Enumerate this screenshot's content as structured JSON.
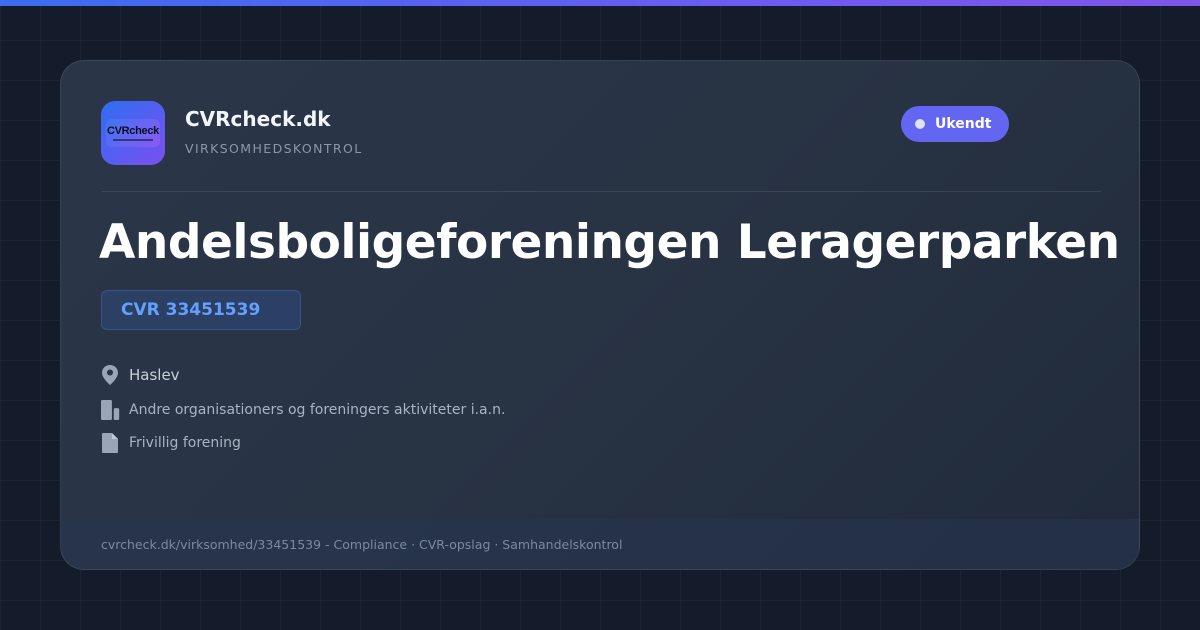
{
  "brand": {
    "logo_text": "CVRcheck",
    "name": "CVRcheck.dk",
    "tagline": "VIRKSOMHEDSKONTROL"
  },
  "status": {
    "label": "Ukendt",
    "color": "#6366f1"
  },
  "company": {
    "name": "Andelsboligeforeningen Leragerparken",
    "cvr": "CVR 33451539",
    "city": "Haslev",
    "industry": "Andre organisationers og foreningers aktiviteter i.a.n.",
    "company_type": "Frivillig forening"
  },
  "icons": {
    "city": "location-pin-icon",
    "industry": "building-icon",
    "company_type": "document-icon"
  },
  "footer": {
    "text": "cvrcheck.dk/virksomhed/33451539 - Compliance · CVR-opslag · Samhandelskontrol"
  },
  "colors": {
    "background": "#141c2c",
    "accent_blue": "#3b6df0",
    "accent_purple": "#7f56ee",
    "cvr_text": "#64a0ff"
  }
}
